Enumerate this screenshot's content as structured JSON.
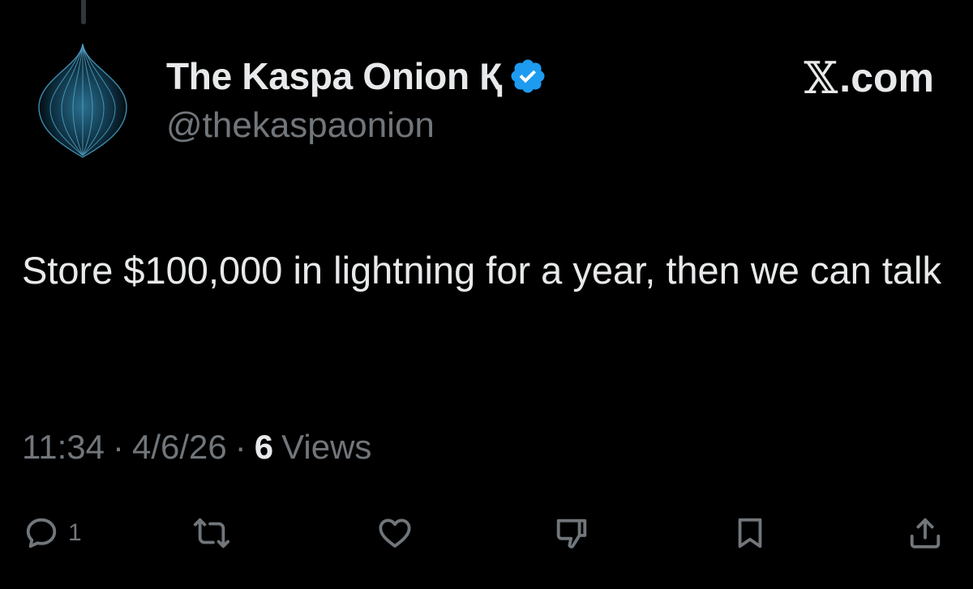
{
  "author": {
    "display_name": "The Kaspa Onion Қ",
    "handle": "@thekaspaonion",
    "verified": true,
    "avatar_icon": "onion-avatar",
    "badge_color": "#1d9bf0"
  },
  "brand": {
    "mark": "𝕏",
    "suffix": ".com"
  },
  "tweet": {
    "text": "Store $100,000 in lightning for a year, then we can talk"
  },
  "meta": {
    "time": "11:34",
    "separator": "·",
    "date": "4/6/26",
    "views_count": "6",
    "views_label": "Views"
  },
  "actions": {
    "reply": {
      "icon": "reply-icon",
      "count": "1"
    },
    "repost": {
      "icon": "repost-icon"
    },
    "like": {
      "icon": "heart-icon"
    },
    "dislike": {
      "icon": "thumbs-down-icon"
    },
    "bookmark": {
      "icon": "bookmark-icon"
    },
    "share": {
      "icon": "share-icon"
    }
  },
  "colors": {
    "background": "#000000",
    "primary_text": "#e7e9ea",
    "secondary_text": "#71767b",
    "accent": "#1d9bf0"
  }
}
